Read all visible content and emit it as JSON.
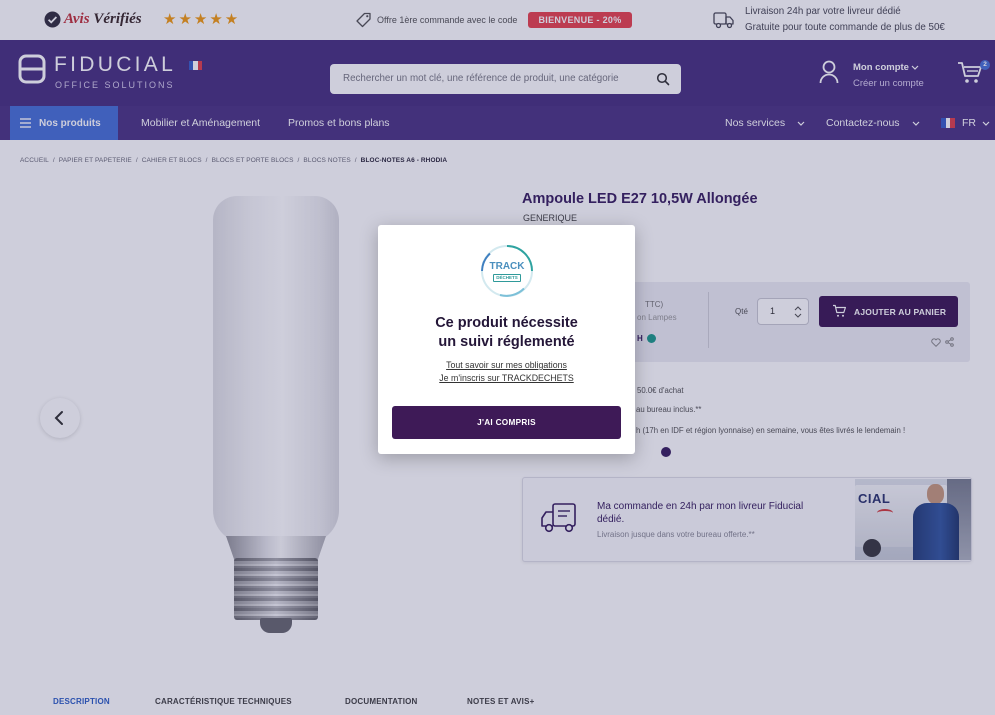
{
  "colors": {
    "brand_purple": "#4a3380",
    "nav_purple": "#4e3784",
    "accent_blue": "#4a72d6",
    "promo_red": "#e8444f",
    "star_orange": "#f39c12",
    "button_purple": "#3e1a57",
    "title_purple": "#3a2160"
  },
  "topbar": {
    "avis_word": "Avis",
    "verifies_word": "Vérifiés",
    "stars": "★★★★★",
    "offer_icon": "tag-icon",
    "offer_text": "Offre 1ère commande avec le code",
    "offer_code": "BIENVENUE - 20%",
    "delivery_icon": "truck-icon",
    "delivery_line1": "Livraison 24h par votre livreur dédié",
    "delivery_line2": "Gratuite pour toute commande de plus de 50€"
  },
  "header": {
    "logo_main": "FIDUCIAL",
    "logo_sub": "OFFICE SOLUTIONS",
    "search_placeholder": "Rechercher un mot clé, une référence de produit, une catégorie",
    "account_title": "Mon compte",
    "account_sub": "Créer un compte",
    "cart_count": "2"
  },
  "nav": {
    "products_label": "Nos produits",
    "items": [
      "Mobilier et Aménagement",
      "Promos et bons plans"
    ],
    "services": "Nos services",
    "contact": "Contactez-nous",
    "lang": "FR"
  },
  "breadcrumb": {
    "separator": "/",
    "items": [
      "ACCUEIL",
      "PAPIER ET PAPETERIE",
      "CAHIER ET BLOCS",
      "BLOCS ET PORTE BLOCS",
      "BLOCS NOTES",
      "BLOC-NOTES A6 - RHODIA"
    ]
  },
  "product": {
    "title": "Ampoule LED E27 10,5W Allongée",
    "brand": "GENERIQUE",
    "price_fragment_1": "TTC)",
    "price_fragment_2": "on Lampes",
    "price_fragment_3": "H",
    "qty_label": "Qté",
    "qty_value": "1",
    "add_to_cart": "AJOUTER AU PANIER",
    "info_lines": [
      "50.0€ d'achat",
      "au bureau inclus.**",
      "h (17h en IDF et région lyonnaise) en semaine, vous êtes livrés le lendemain !"
    ]
  },
  "delivery_card": {
    "title_line1": "Ma commande en 24h par mon livreur Fiducial",
    "title_line2": "dédié.",
    "sub": "Livraison jusque dans votre bureau offerte.**",
    "van_text": "CIAL"
  },
  "tabs": [
    "DESCRIPTION",
    "CARACTÉRISTIQUE TECHNIQUES",
    "DOCUMENTATION",
    "NOTES ET AVIS+"
  ],
  "modal": {
    "logo_line1": "TRACK",
    "logo_line2": "DÉCHETS",
    "heading_line1": "Ce produit nécessite",
    "heading_line2": "un suivi réglementé",
    "link1": "Tout savoir sur mes obligations",
    "link2": "Je m'inscris sur TRACKDECHETS",
    "button": "J'AI COMPRIS"
  }
}
